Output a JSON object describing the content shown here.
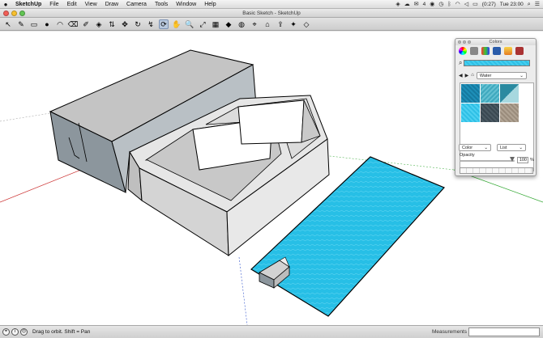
{
  "menubar": {
    "app": "SketchUp",
    "menus": [
      "File",
      "Edit",
      "View",
      "Draw",
      "Camera",
      "Tools",
      "Window",
      "Help"
    ],
    "status": {
      "battery": "(0:27)",
      "clock": "Tue 23:00",
      "badge_count": "4"
    }
  },
  "window": {
    "title": "Basic Sketch - SketchUp"
  },
  "toolbar": {
    "tools": [
      {
        "name": "select-tool",
        "glyph": "↖"
      },
      {
        "name": "pencil-tool",
        "glyph": "✎"
      },
      {
        "name": "rectangle-tool",
        "glyph": "▭"
      },
      {
        "name": "circle-tool",
        "glyph": "●"
      },
      {
        "name": "arc-tool",
        "glyph": "◠"
      },
      {
        "name": "eraser-tool",
        "glyph": "⌫"
      },
      {
        "name": "tape-measure-tool",
        "glyph": "✐"
      },
      {
        "name": "paint-bucket-tool",
        "glyph": "◈"
      },
      {
        "name": "push-pull-tool",
        "glyph": "⇅"
      },
      {
        "name": "move-tool",
        "glyph": "✥"
      },
      {
        "name": "rotate-tool",
        "glyph": "↻"
      },
      {
        "name": "follow-me-tool",
        "glyph": "↯"
      },
      {
        "name": "orbit-tool",
        "glyph": "⟳"
      },
      {
        "name": "pan-tool",
        "glyph": "✋"
      },
      {
        "name": "zoom-tool",
        "glyph": "🔍"
      },
      {
        "name": "zoom-extents-tool",
        "glyph": "⤢"
      },
      {
        "name": "section-plane-tool",
        "glyph": "▦"
      },
      {
        "name": "components-tool",
        "glyph": "◆"
      },
      {
        "name": "materials-tool",
        "glyph": "◍"
      },
      {
        "name": "add-location-tool",
        "glyph": "⌖"
      },
      {
        "name": "warehouse-tool",
        "glyph": "⌂"
      },
      {
        "name": "share-model-tool",
        "glyph": "⇪"
      },
      {
        "name": "extension-tool",
        "glyph": "✦"
      },
      {
        "name": "preview-tool",
        "glyph": "◇"
      }
    ],
    "active_tool": "orbit-tool"
  },
  "colors_panel": {
    "title": "Colors",
    "library": "Water",
    "selected_material": "Water",
    "color_mode": "Color",
    "view_mode": "List",
    "opacity_label": "Opacity",
    "opacity": "100",
    "percent_sign": "%",
    "textures": [
      "#1a7fa5",
      "#4fb1c6",
      "#88c7d1",
      "#39b7df",
      "#3d4b55",
      "#9d8f80"
    ]
  },
  "statusbar": {
    "hint": "Drag to orbit.  Shift = Pan",
    "measurements_label": "Measurements"
  },
  "colors": {
    "accent": "#1eb3db",
    "pool": "#27bfe6",
    "wall_dark": "#8c969d",
    "wall_light": "#d6d6d6",
    "ground": "#ffffff"
  }
}
